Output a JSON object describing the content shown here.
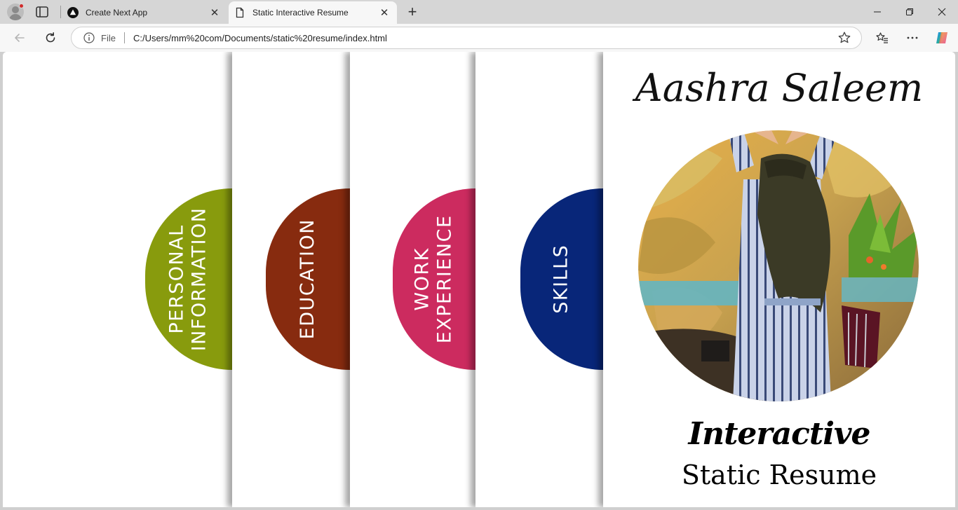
{
  "browser": {
    "tabs": [
      {
        "title": "Create Next App",
        "active": false
      },
      {
        "title": "Static Interactive Resume",
        "active": true
      }
    ],
    "address_bar": {
      "scheme_label": "File",
      "url": "C:/Users/mm%20com/Documents/static%20resume/index.html"
    },
    "icons": {
      "profile": "profile-avatar-icon",
      "tab_actions": "tab-actions-icon",
      "next_favicon": "nextjs-triangle-icon",
      "page_favicon": "document-icon",
      "new_tab": "plus-icon",
      "back": "back-arrow-icon",
      "reload": "reload-icon",
      "info": "info-icon",
      "favorite": "star-icon",
      "favorites_list": "favorites-icon",
      "more": "more-icon",
      "copilot": "copilot-icon"
    }
  },
  "resume": {
    "sections": [
      {
        "label": "Personal\nInformation",
        "color": "#889b0d"
      },
      {
        "label": "Education",
        "color": "#872b0f"
      },
      {
        "label": "Work\nExperience",
        "color": "#cc2b5f"
      },
      {
        "label": "Skills",
        "color": "#082679"
      }
    ],
    "name": "Aashra Saleem",
    "subtitle_line1": "Interactive",
    "subtitle_line2": "Static Resume"
  }
}
